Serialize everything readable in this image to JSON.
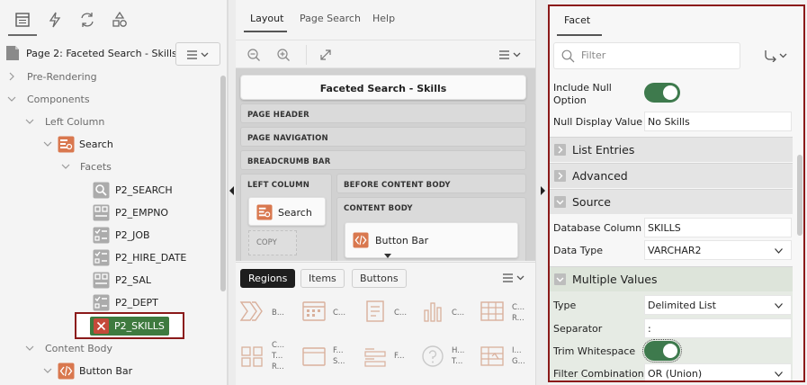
{
  "left": {
    "page_title": "Page 2: Faceted Search - Skills",
    "tree": [
      {
        "label": "Pre-Rendering"
      },
      {
        "label": "Components"
      },
      {
        "label": "Left Column"
      },
      {
        "label": "Search"
      },
      {
        "label": "Facets"
      },
      {
        "label": "P2_SEARCH"
      },
      {
        "label": "P2_EMPNO"
      },
      {
        "label": "P2_JOB"
      },
      {
        "label": "P2_HIRE_DATE"
      },
      {
        "label": "P2_SAL"
      },
      {
        "label": "P2_DEPT"
      },
      {
        "label": "P2_SKILLS"
      },
      {
        "label": "Content Body"
      },
      {
        "label": "Button Bar"
      }
    ]
  },
  "center": {
    "tabs": [
      "Layout",
      "Page Search",
      "Help"
    ],
    "layout": {
      "page_heading": "Faceted Search - Skills",
      "regions": {
        "page_header": "PAGE HEADER",
        "page_navigation": "PAGE NAVIGATION",
        "breadcrumb_bar": "BREADCRUMB BAR",
        "left_column": "LEFT COLUMN",
        "before_content_body": "BEFORE CONTENT BODY",
        "content_body": "CONTENT BODY"
      },
      "search_card": "Search",
      "copy_label": "COPY",
      "button_bar_card": "Button Bar"
    },
    "gallery_tabs": [
      "Regions",
      "Items",
      "Buttons"
    ],
    "gallery_items": [
      {
        "icon": "chevrons-icon",
        "text": "B..."
      },
      {
        "icon": "calendar-icon",
        "text": "C..."
      },
      {
        "icon": "document-icon",
        "text": "C..."
      },
      {
        "icon": "bar-chart-icon",
        "text": "C..."
      },
      {
        "icon": "table-icon",
        "text": "C...\nR..."
      },
      {
        "icon": "card-list-icon",
        "text": "C...\nT...\nR..."
      },
      {
        "icon": "window-icon",
        "text": "F...\nS..."
      },
      {
        "icon": "form-icon",
        "text": "F..."
      },
      {
        "icon": "help-icon",
        "text": "H...\nT..."
      },
      {
        "icon": "grid-icon",
        "text": "I...\nG..."
      }
    ]
  },
  "right": {
    "tab": "Facet",
    "filter_placeholder": "Filter",
    "properties": {
      "include_null_label": "Include Null\nOption",
      "null_display_label": "Null Display Value",
      "null_display_value": "No Skills",
      "list_entries": "List Entries",
      "advanced": "Advanced",
      "source": "Source",
      "db_column_label": "Database Column",
      "db_column_value": "SKILLS",
      "data_type_label": "Data Type",
      "data_type_value": "VARCHAR2",
      "multiple_values": "Multiple Values",
      "type_label": "Type",
      "type_value": "Delimited List",
      "separator_label": "Separator",
      "separator_value": ":",
      "trim_label": "Trim Whitespace",
      "filter_comb_label": "Filter Combination",
      "filter_comb_value": "OR (Union)"
    },
    "include_null_on": true,
    "trim_whitespace_on": true
  },
  "colors": {
    "accent_red": "#8b1a1a",
    "toggle_green": "#3e7a4d",
    "selected_pill": "#3e7a3f",
    "icon_orange": "#c9623a"
  }
}
